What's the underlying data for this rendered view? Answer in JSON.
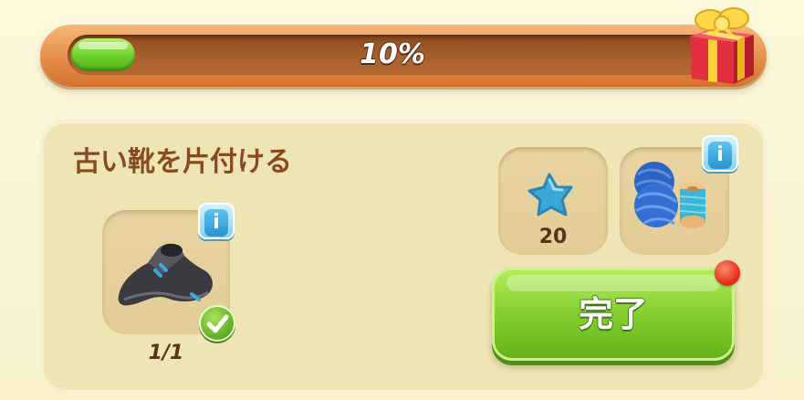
{
  "progress": {
    "value": 0.1,
    "label": "10%"
  },
  "task": {
    "title": "古い靴を片付ける",
    "required_item": {
      "name": "old-shoe",
      "count_label": "1/1",
      "completed": true
    },
    "rewards": [
      {
        "name": "star",
        "amount_label": "20"
      },
      {
        "name": "yarn-and-spools"
      }
    ],
    "complete_button_label": "完了"
  },
  "colors": {
    "progress_fill": "#6ccf2a",
    "button_green": "#7fcc2c",
    "title_brown": "#8a4a20",
    "info_blue": "#2a93cf",
    "notify_red": "#e32810"
  },
  "icons": [
    "gift-box-icon",
    "info-icon",
    "check-icon",
    "star-icon",
    "yarn-icon",
    "old-shoe-icon"
  ]
}
